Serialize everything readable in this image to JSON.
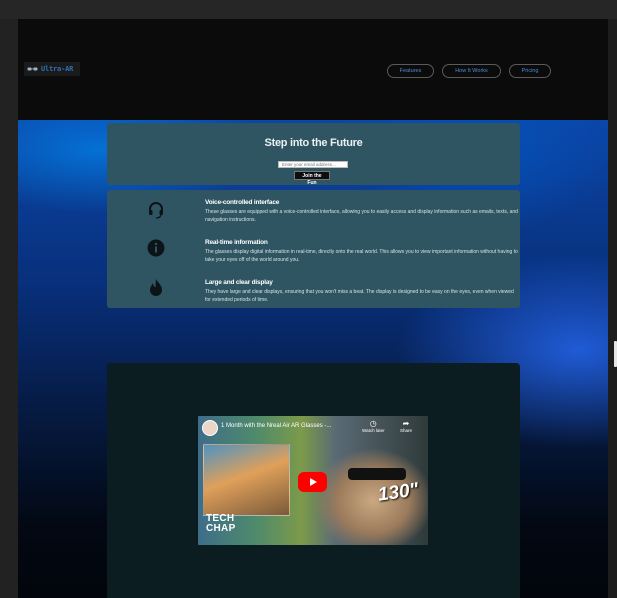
{
  "header": {
    "logo_text": "Ultra-AR",
    "nav": [
      "Features",
      "How It Works",
      "Pricing"
    ]
  },
  "cta": {
    "title": "Step into the Future",
    "email_placeholder": "Enter your email address...",
    "button_label": "Join the Fun"
  },
  "features": [
    {
      "icon": "headset-icon",
      "title": "Voice-controlled interface",
      "description": "These glasses are equipped with a voice-controlled interface, allowing you to easily access and display information such as emails, texts, and navigation instructions."
    },
    {
      "icon": "info-icon",
      "title": "Real-time information",
      "description": "The glasses display digital information in real-time, directly onto the real world. This allows you to view important information without having to take your eyes off of the world around you."
    },
    {
      "icon": "fire-icon",
      "title": "Large and clear display",
      "description": "They have large and clear displays, ensuring that you won't miss a beat. The display is designed to be easy on the eyes, even when viewed for extended periods of time."
    }
  ],
  "video": {
    "title": "1 Month with the Nreal Air AR Glasses -...",
    "watch_later": "Watch later",
    "share": "Share",
    "brand_line1": "TECH",
    "brand_line2": "CHAP",
    "overlay_number": "130\""
  },
  "colors": {
    "card": "#2f5563",
    "nav_text": "#4b8fd6",
    "video_card": "#0c1d22"
  }
}
